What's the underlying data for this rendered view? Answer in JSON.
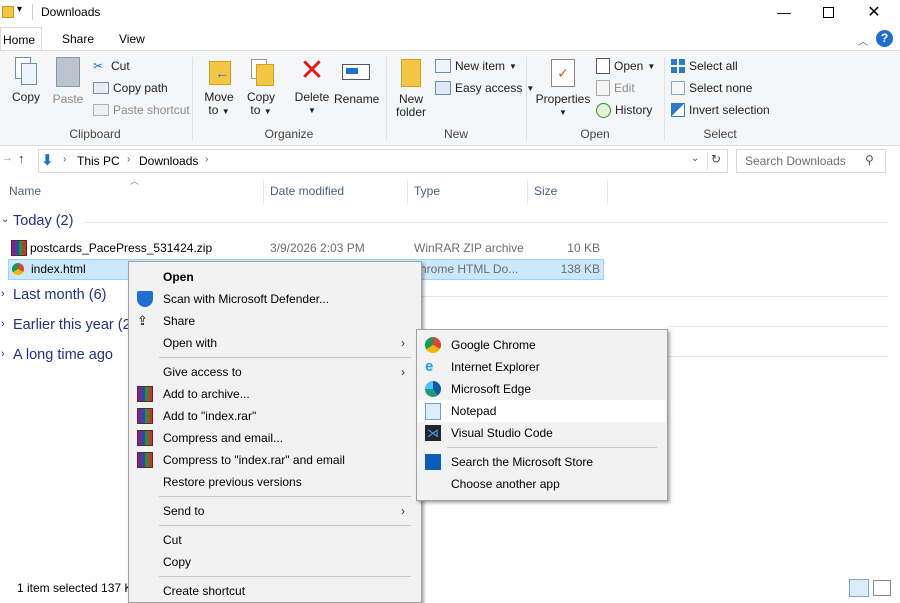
{
  "window": {
    "title": "Downloads"
  },
  "ribbon_tabs": [
    "Home",
    "Share",
    "View"
  ],
  "ribbon": {
    "clipboard": {
      "copy": "Copy",
      "paste": "Paste",
      "cut": "Cut",
      "copy_path": "Copy path",
      "paste_shortcut": "Paste shortcut",
      "label": "Clipboard"
    },
    "organize": {
      "move_to_1": "Move",
      "move_to_2": "to",
      "copy_to_1": "Copy",
      "copy_to_2": "to",
      "delete": "Delete",
      "rename": "Rename",
      "label": "Organize"
    },
    "new": {
      "new_folder_1": "New",
      "new_folder_2": "folder",
      "new_item": "New item",
      "easy_access": "Easy access",
      "label": "New"
    },
    "open": {
      "properties": "Properties",
      "open": "Open",
      "edit": "Edit",
      "history": "History",
      "label": "Open"
    },
    "select": {
      "select_all": "Select all",
      "select_none": "Select none",
      "invert": "Invert selection",
      "label": "Select"
    }
  },
  "address": {
    "crumbs": [
      "This PC",
      "Downloads"
    ],
    "search_placeholder": "Search Downloads"
  },
  "columns": [
    "Name",
    "Date modified",
    "Type",
    "Size"
  ],
  "groups": {
    "today": "Today (2)",
    "last_month": "Last month (6)",
    "earlier_year": "Earlier this year (2",
    "long_ago": "A long time ago"
  },
  "files": [
    {
      "name": "postcards_PacePress_531424.zip",
      "date": "3/9/2026 2:03 PM",
      "type": "WinRAR ZIP archive",
      "size": "10 KB"
    },
    {
      "name": "index.html",
      "type": "hrome HTML Do...",
      "size": "138 KB"
    }
  ],
  "status": {
    "selected": "1 item selected  137 K"
  },
  "context_menu": {
    "open": "Open",
    "scan": "Scan with Microsoft Defender...",
    "share": "Share",
    "open_with": "Open with",
    "give_access": "Give access to",
    "add_archive": "Add to archive...",
    "add_rar": "Add to \"index.rar\"",
    "compress_email": "Compress and email...",
    "compress_rar_email": "Compress to \"index.rar\" and email",
    "restore": "Restore previous versions",
    "send_to": "Send to",
    "cut": "Cut",
    "copy": "Copy",
    "create_shortcut": "Create shortcut"
  },
  "open_with_menu": {
    "chrome": "Google Chrome",
    "ie": "Internet Explorer",
    "edge": "Microsoft Edge",
    "notepad": "Notepad",
    "vscode": "Visual Studio Code",
    "store": "Search the Microsoft Store",
    "choose": "Choose another app"
  },
  "colors": {
    "accent": "#0078d7",
    "selection": "#cce8ff",
    "group_text": "#1e3287"
  }
}
